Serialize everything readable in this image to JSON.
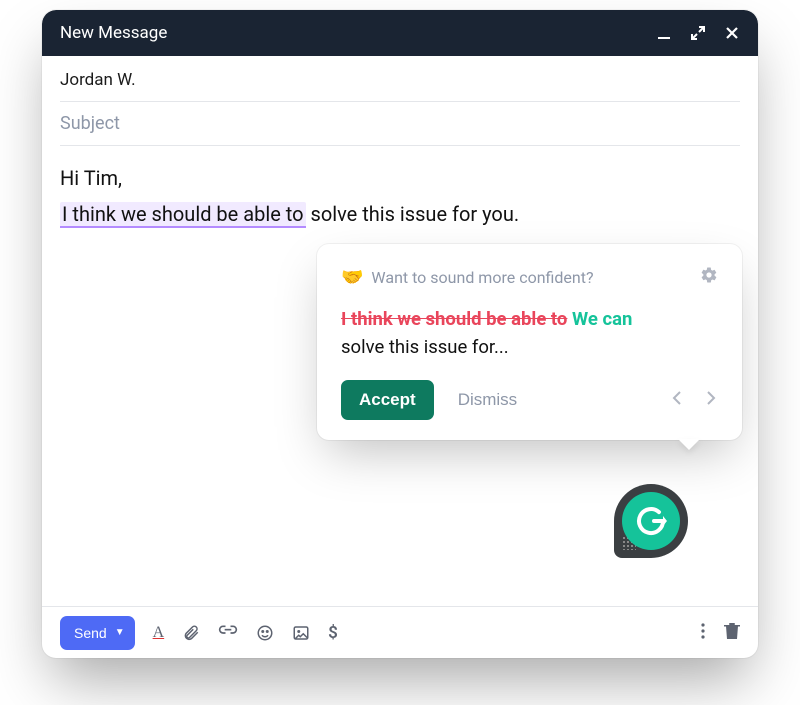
{
  "titlebar": {
    "title": "New Message"
  },
  "fields": {
    "to_value": "Jordan W.",
    "subject_placeholder": "Subject"
  },
  "body": {
    "greeting": "Hi Tim,",
    "highlighted": "I think we should be able to",
    "rest": " solve this issue for you."
  },
  "popup": {
    "emoji": "🤝",
    "prompt": "Want to sound more confident?",
    "strike_text": "I think we should be able to",
    "insert_text": "We can",
    "trailing_text": "solve this issue for...",
    "accept_label": "Accept",
    "dismiss_label": "Dismiss"
  },
  "toolbar": {
    "send_label": "Send"
  }
}
